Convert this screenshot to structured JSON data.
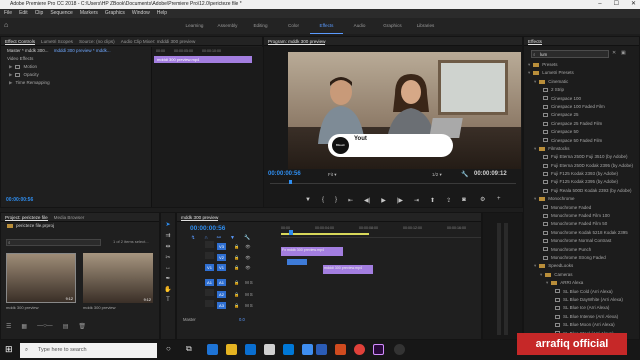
{
  "window": {
    "title": "Adobe Premiere Pro CC 2018 - C:\\Users\\HP ZBook\\Documents\\Adobe\\Premiere Pro\\12.0\\pericteze file *"
  },
  "menu": [
    "File",
    "Edit",
    "Clip",
    "Sequence",
    "Markers",
    "Graphics",
    "Window",
    "Help"
  ],
  "workspaces": [
    "Learning",
    "Assembly",
    "Editing",
    "Color",
    "Effects",
    "Audio",
    "Graphics",
    "Libraries"
  ],
  "workspace_active": "Effects",
  "effect_controls": {
    "tabs": [
      "Effect Controls",
      "Lumetri Scopes",
      "Source: (no clips)",
      "Audio Clip Mixer: mdddi 300 preview"
    ],
    "master": "Master * mddk 300...",
    "clip": "mdddi 300 preview * mddk...",
    "clip_label": "mdddi 300 preview.mp4",
    "rows": [
      "Video Effects",
      "Motion",
      "Opacity",
      "Time Remapping"
    ],
    "timecode": "00:00:00:56",
    "ruler": [
      "00:00",
      "00:00:05:00",
      "00:00:10:00"
    ]
  },
  "program": {
    "tab": "Program: mddk 300 preview",
    "lower_third": "Yout",
    "logo_text": "Bikash",
    "timecode_current": "00:00:00:56",
    "fit": "Fit",
    "quality": "1/2",
    "timecode_total": "00:00:09:12"
  },
  "effects": {
    "tab": "Effects",
    "search": "lum",
    "items": [
      {
        "label": "Presets",
        "kind": "folder",
        "level": 0
      },
      {
        "label": "Lumetri Presets",
        "kind": "folder",
        "level": 0
      },
      {
        "label": "Cinematic",
        "kind": "folder",
        "level": 1
      },
      {
        "label": "2 Strip",
        "kind": "fx",
        "level": 2
      },
      {
        "label": "Cinespace 100",
        "kind": "fx",
        "level": 2
      },
      {
        "label": "Cinespace 100 Faded Film",
        "kind": "fx",
        "level": 2
      },
      {
        "label": "Cinespace 25",
        "kind": "fx",
        "level": 2
      },
      {
        "label": "Cinespace 25 Faded Film",
        "kind": "fx",
        "level": 2
      },
      {
        "label": "Cinespace 50",
        "kind": "fx",
        "level": 2
      },
      {
        "label": "Cinespace 50 Faded Film",
        "kind": "fx",
        "level": 2
      },
      {
        "label": "Filmstocks",
        "kind": "folder",
        "level": 1
      },
      {
        "label": "Fuji Eterna 250D Fuji 3510 (by Adobe)",
        "kind": "fx",
        "level": 2
      },
      {
        "label": "Fuji Eterna 250D Kodak 2395 (by Adobe)",
        "kind": "fx",
        "level": 2
      },
      {
        "label": "Fuji F125 Kodak 2393 (by Adobe)",
        "kind": "fx",
        "level": 2
      },
      {
        "label": "Fuji F125 Kodak 2395 (by Adobe)",
        "kind": "fx",
        "level": 2
      },
      {
        "label": "Fuji Reala 500D Kodak 2393 (by Adobe)",
        "kind": "fx",
        "level": 2
      },
      {
        "label": "Monochrome",
        "kind": "folder",
        "level": 1
      },
      {
        "label": "Monochrome Faded",
        "kind": "fx",
        "level": 2
      },
      {
        "label": "Monochrome Faded Film 100",
        "kind": "fx",
        "level": 2
      },
      {
        "label": "Monochrome Faded Film 50",
        "kind": "fx",
        "level": 2
      },
      {
        "label": "Monochrome Kodak 5218 Kodak 2395",
        "kind": "fx",
        "level": 2
      },
      {
        "label": "Monochrome Normal Contrast",
        "kind": "fx",
        "level": 2
      },
      {
        "label": "Monochrome Punch",
        "kind": "fx",
        "level": 2
      },
      {
        "label": "Monochrome Strong Faded",
        "kind": "fx",
        "level": 2
      },
      {
        "label": "SpeedLooks",
        "kind": "folder",
        "level": 1
      },
      {
        "label": "Cameras",
        "kind": "folder",
        "level": 2
      },
      {
        "label": "ARRI Alexa",
        "kind": "folder",
        "level": 3
      },
      {
        "label": "SL Blue Cold (Arri Alexa)",
        "kind": "fx",
        "level": 4
      },
      {
        "label": "SL Blue DayWhite (Arri Alexa)",
        "kind": "fx",
        "level": 4
      },
      {
        "label": "SL Blue Ice (Arri Alexa)",
        "kind": "fx",
        "level": 4
      },
      {
        "label": "SL Blue Intense (Arri Alexa)",
        "kind": "fx",
        "level": 4
      },
      {
        "label": "SL Blue Moon (Arri Alexa)",
        "kind": "fx",
        "level": 4
      },
      {
        "label": "SL Blue Steel (Arri Alexa)",
        "kind": "fx",
        "level": 4
      }
    ]
  },
  "project": {
    "tabs": [
      "Project: pericteze file",
      "Media Browser"
    ],
    "file": "pericteze file.prproj",
    "selection": "1 of 2 items select...",
    "thumbs": [
      {
        "name": "mddk 300 preview",
        "duration": "9:12"
      },
      {
        "name": "mddk 300 preview",
        "duration": "9:12"
      }
    ]
  },
  "timeline": {
    "tab": "mddk 300 preview",
    "timecode": "00:00:00:56",
    "ruler": [
      "00:00",
      "00:00:04:00",
      "00:00:08:00",
      "00:00:12:00",
      "00:00:16:00"
    ],
    "tracks": [
      "V3",
      "V2",
      "V1",
      "A1",
      "A2",
      "A3"
    ],
    "master": "Master",
    "master_value": "0.0",
    "clips": [
      "Fx mddk 300 preview.mp4",
      "mdddi 300 preview.mp4"
    ]
  },
  "taskbar": {
    "search_placeholder": "Type here to search"
  },
  "watermark": "arrafiq official"
}
